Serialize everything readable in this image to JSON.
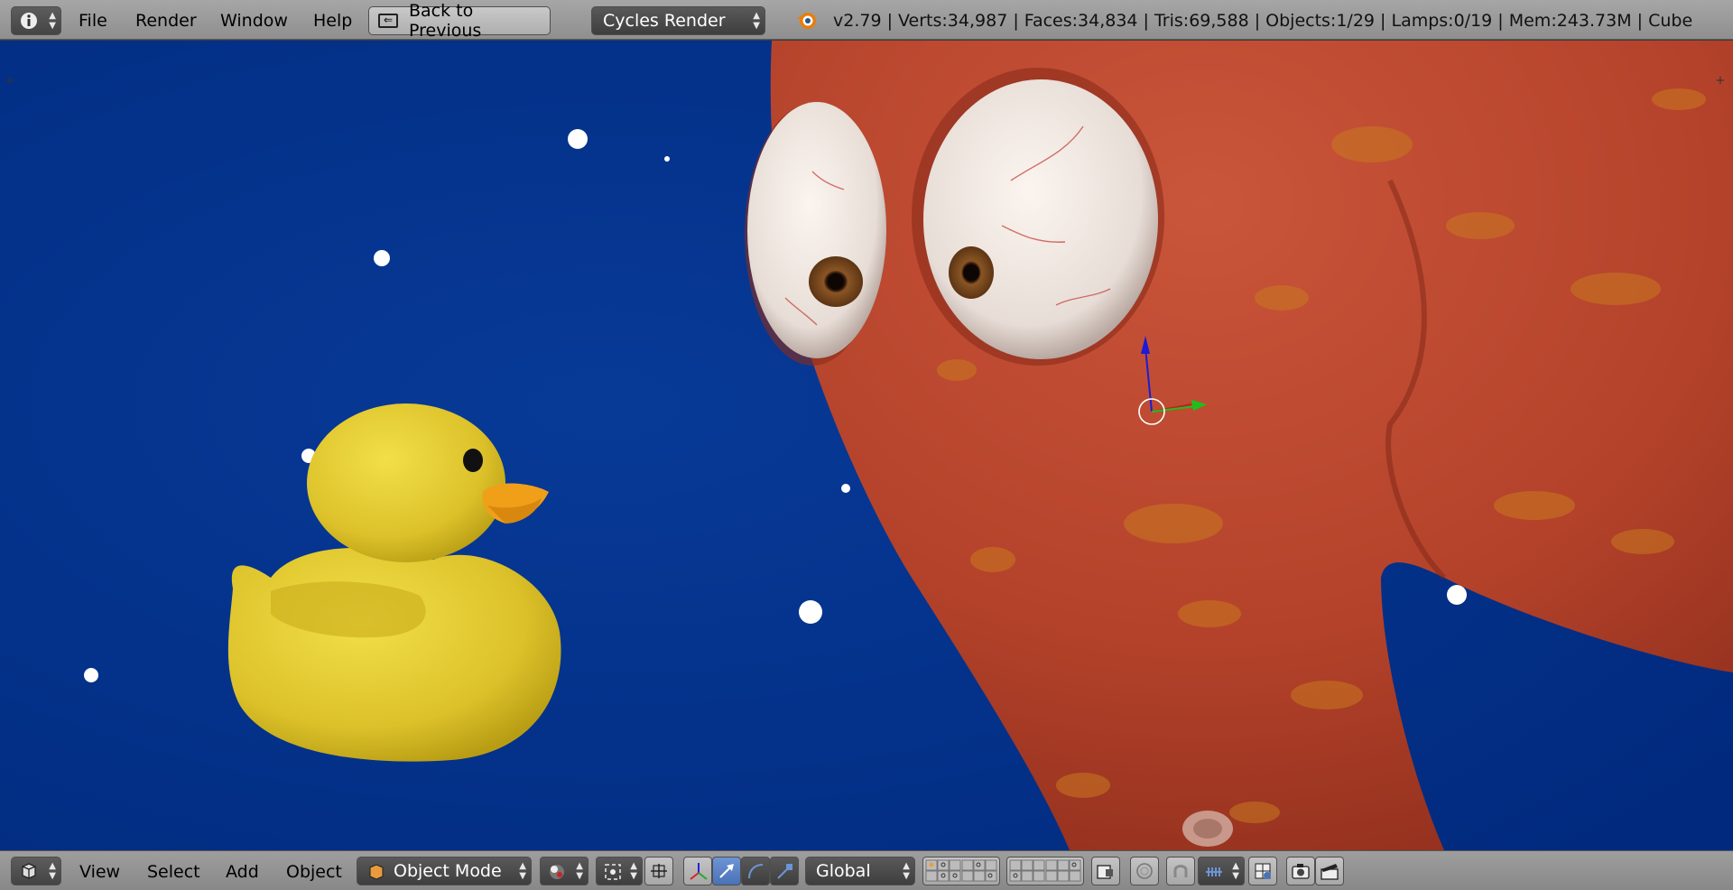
{
  "topbar": {
    "menu": [
      "File",
      "Render",
      "Window",
      "Help"
    ],
    "back_label": "Back to Previous",
    "engine": "Cycles Render",
    "stats": "v2.79 | Verts:34,987 | Faces:34,834 | Tris:69,588 | Objects:1/29 | Lamps:0/19 | Mem:243.73M | Cube"
  },
  "bottombar": {
    "menu": [
      "View",
      "Select",
      "Add",
      "Object"
    ],
    "mode": "Object Mode",
    "orientation": "Global"
  },
  "colors": {
    "viewport_bg": "#002a80",
    "duck": "#e8d12a",
    "octopus": "#b8452d",
    "manipulator_active": "#5680c2"
  }
}
